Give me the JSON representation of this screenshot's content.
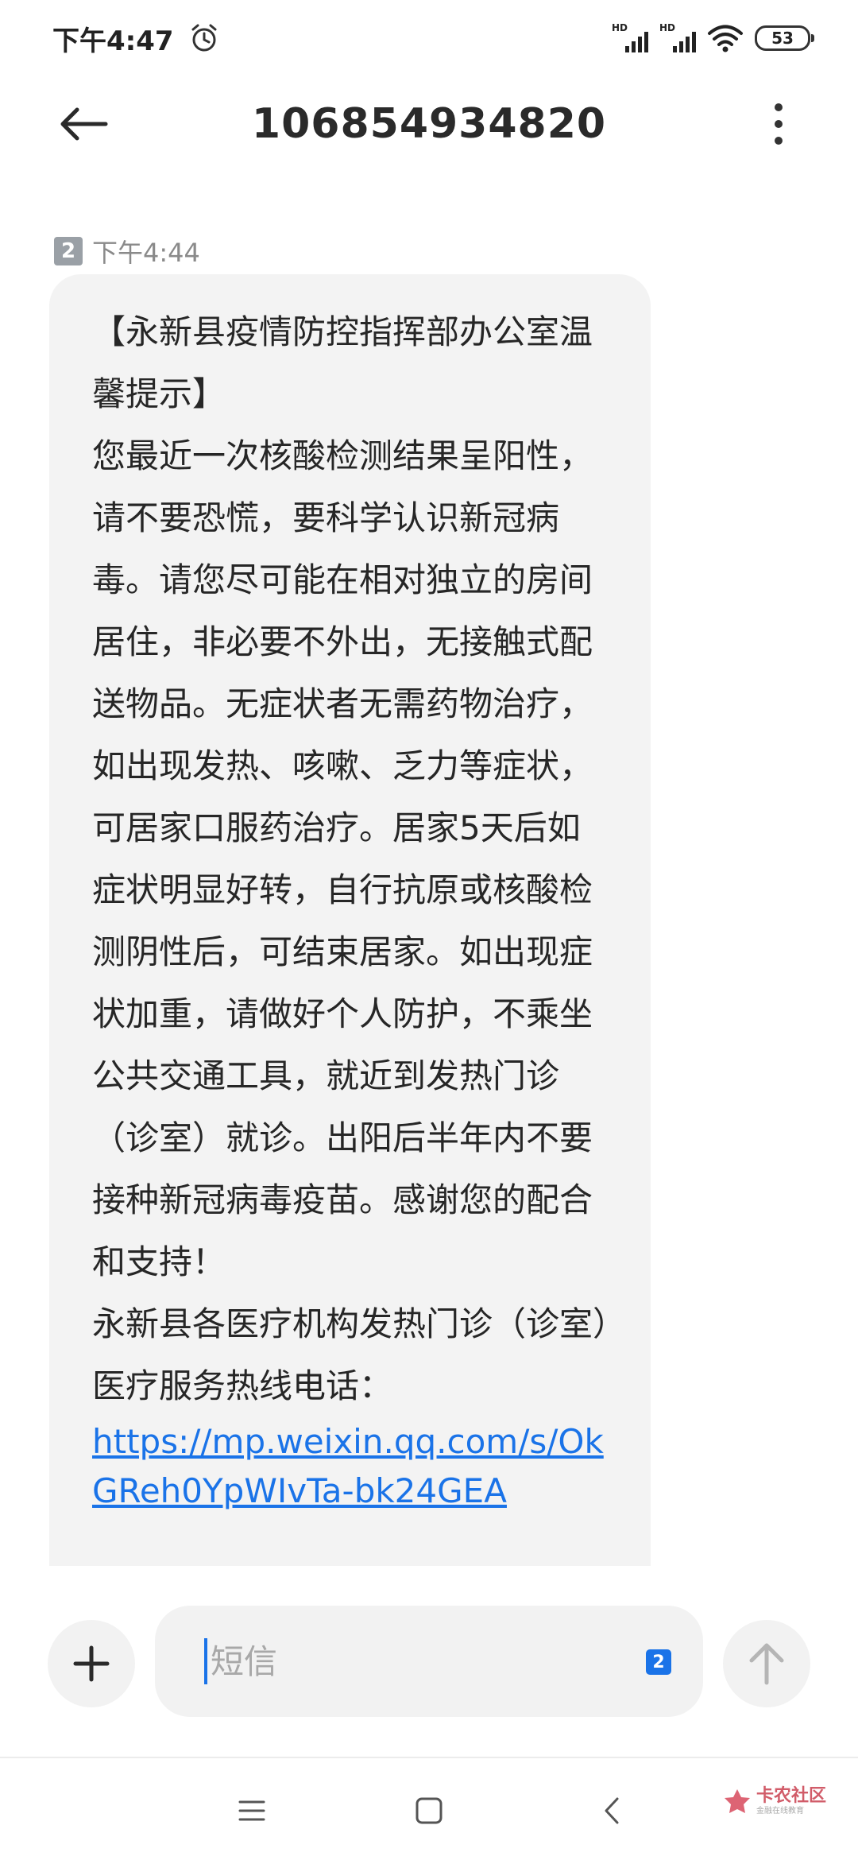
{
  "status_bar": {
    "time": "下午4:47",
    "signal1_label": "HD",
    "signal2_label": "HD",
    "battery": "53"
  },
  "header": {
    "title": "106854934820"
  },
  "message": {
    "sim_slot": "2",
    "time": "下午4:44",
    "body": "【永新县疫情防控指挥部办公室温馨提示】\n您最近一次核酸检测结果呈阳性，请不要恐慌，要科学认识新冠病毒。请您尽可能在相对独立的房间居住，非必要不外出，无接触式配送物品。无症状者无需药物治疗，如出现发热、咳嗽、乏力等症状，可居家口服药治疗。居家5天后如症状明显好转，自行抗原或核酸检测阴性后，可结束居家。如出现症状加重，请做好个人防护，不乘坐公共交通工具，就近到发热门诊（诊室）就诊。出阳后半年内不要接种新冠病毒疫苗。感谢您的配合和支持！\n永新县各医疗机构发热门诊（诊室）医疗服务热线电话：",
    "link": "https://mp.weixin.qq.com/s/OkGReh0YpWIvTa-bk24GEA"
  },
  "composer": {
    "placeholder": "短信",
    "sim_badge": "2"
  },
  "watermark": {
    "title": "卡农社区",
    "subtitle": "金融在线教育"
  },
  "colors": {
    "link": "#1a73e8",
    "bubble": "#f3f3f3",
    "accent": "#1a73e8"
  }
}
